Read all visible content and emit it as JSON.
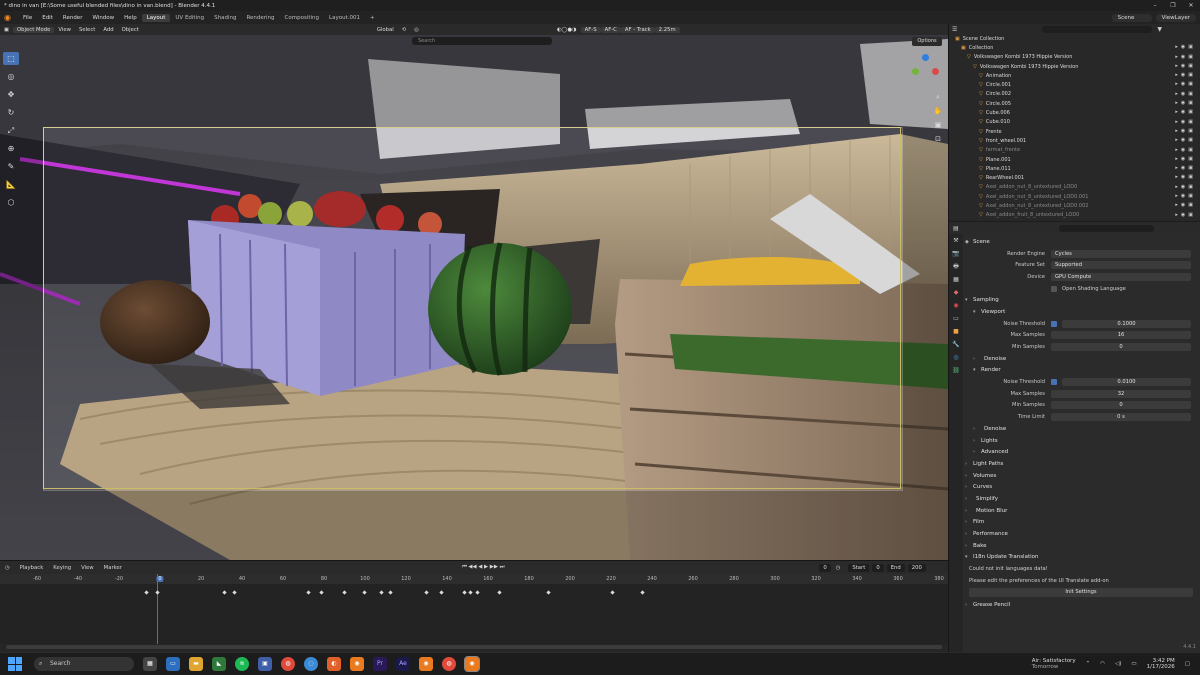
{
  "window": {
    "title": "* dino in van [E:\\Some useful blended files\\dino in van.blend] - Blender 4.4.1",
    "controls": [
      "–",
      "❐",
      "✕"
    ]
  },
  "menu": {
    "items": [
      "File",
      "Edit",
      "Render",
      "Window",
      "Help"
    ],
    "workspaces": [
      "Layout",
      "UV Editing",
      "Shading",
      "Rendering",
      "Compositing",
      "Layout.001"
    ],
    "add_tab": "+",
    "scene": "Scene",
    "view_layer": "ViewLayer"
  },
  "viewport": {
    "mode": "Object Mode",
    "menus": [
      "View",
      "Select",
      "Add",
      "Object"
    ],
    "orientation": "Global",
    "af_s": "AF-S",
    "af_c": "AF-C",
    "af_track": "AF - Track",
    "focus_distance": "2.25m",
    "search_placeholder": "Search",
    "options": "Options"
  },
  "timeline": {
    "menus": [
      "Playback",
      "Keying",
      "View",
      "Marker"
    ],
    "current_frame": "0",
    "start_label": "Start",
    "start": "0",
    "end_label": "End",
    "end": "200",
    "ruler_labels": [
      "-60",
      "-40",
      "-20",
      "0",
      "20",
      "40",
      "60",
      "80",
      "100",
      "120",
      "140",
      "160",
      "180",
      "200",
      "220",
      "240",
      "260",
      "280",
      "300",
      "320",
      "340",
      "360",
      "380"
    ]
  },
  "outliner": {
    "root": "Scene Collection",
    "items": [
      {
        "name": "Collection",
        "level": 1
      },
      {
        "name": "Volkswagen Kombi 1973 Hippie Version",
        "level": 2
      },
      {
        "name": "Volkswagen Kombi 1973 Hippie Version",
        "level": 3
      },
      {
        "name": "Animation",
        "level": 4
      },
      {
        "name": "Circle.001",
        "level": 4
      },
      {
        "name": "Circle.002",
        "level": 4
      },
      {
        "name": "Circle.005",
        "level": 4
      },
      {
        "name": "Cube.006",
        "level": 4
      },
      {
        "name": "Cube.010",
        "level": 4
      },
      {
        "name": "Frente",
        "level": 4
      },
      {
        "name": "front_wheel.001",
        "level": 4
      },
      {
        "name": "farmat_frente",
        "level": 4,
        "dim": true
      },
      {
        "name": "Plane.001",
        "level": 4
      },
      {
        "name": "Plane.011",
        "level": 4
      },
      {
        "name": "RearWheel.001",
        "level": 4
      },
      {
        "name": "Axel_addon_nut_8_untextured_LOD0",
        "level": 4,
        "dim": true
      },
      {
        "name": "Axel_addon_nut_8_untextured_LOD0.001",
        "level": 4,
        "dim": true
      },
      {
        "name": "Axel_addon_nut_8_untextured_LOD0.002",
        "level": 4,
        "dim": true
      },
      {
        "name": "Axel_addon_fruit_8_untextured_LOD0",
        "level": 4,
        "dim": true
      }
    ]
  },
  "properties": {
    "context": "Scene",
    "render_engine_label": "Render Engine",
    "render_engine": "Cycles",
    "feature_set_label": "Feature Set",
    "feature_set": "Supported",
    "device_label": "Device",
    "device": "GPU Compute",
    "osl": "Open Shading Language",
    "sampling": "Sampling",
    "viewport": "Viewport",
    "noise_threshold_label": "Noise Threshold",
    "vp_noise_threshold": "0.1000",
    "max_samples_label": "Max Samples",
    "vp_max_samples": "16",
    "min_samples_label": "Min Samples",
    "vp_min_samples": "0",
    "denoise": "Denoise",
    "render": "Render",
    "r_noise_threshold": "0.0100",
    "r_max_samples": "32",
    "r_min_samples": "0",
    "time_limit_label": "Time Limit",
    "r_time_limit": "0 s",
    "denoise2": "Denoise",
    "lights": "Lights",
    "advanced": "Advanced",
    "sections": [
      "Light Paths",
      "Volumes",
      "Curves",
      "Simplify",
      "Motion Blur",
      "Film",
      "Performance",
      "Bake",
      "I18n Update Translation"
    ],
    "msg1": "Could not init languages data!",
    "msg2": "Please edit the preferences of the UI Translate add-on",
    "init_settings": "Init Settings",
    "grease_pencil": "Grease Pencil",
    "version": "4.4.1"
  },
  "taskbar": {
    "search": "Search",
    "weather_title": "Air: Satisfactory",
    "weather_sub": "Tomorrow",
    "time": "3:42 PM",
    "date": "1/17/2026"
  },
  "colors": {
    "accent": "#4772b3",
    "blender_orange": "#f08a24",
    "camera_frame": "#c9bc6b"
  }
}
